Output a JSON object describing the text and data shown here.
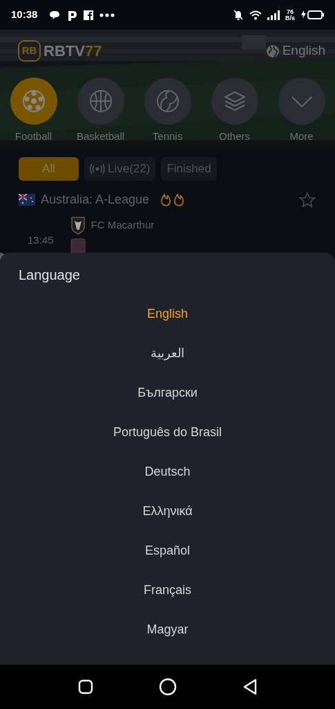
{
  "status_bar": {
    "time": "10:38",
    "net_speed_value": "76",
    "net_speed_unit": "B/s"
  },
  "header": {
    "logo_badge": "RB",
    "brand_main": "RBTV",
    "brand_accent": "77",
    "language_button": "English"
  },
  "sports": [
    {
      "label": "Football",
      "kind": "football",
      "selected": true
    },
    {
      "label": "Basketball",
      "kind": "basketball",
      "selected": false
    },
    {
      "label": "Tennis",
      "kind": "tennis",
      "selected": false
    },
    {
      "label": "Others",
      "kind": "others",
      "selected": false
    },
    {
      "label": "More",
      "kind": "more",
      "selected": false
    }
  ],
  "filters": [
    {
      "label": "All",
      "kind": "plain",
      "selected": true
    },
    {
      "label": "Live(22)",
      "kind": "live",
      "selected": false
    },
    {
      "label": "Finished",
      "kind": "plain",
      "selected": false
    }
  ],
  "league": {
    "name": "Australia: A-League"
  },
  "match": {
    "time": "13:45",
    "home_team": "FC Macarthur"
  },
  "language_sheet": {
    "title": "Language",
    "items": [
      {
        "label": "English",
        "selected": true
      },
      {
        "label": "العربية",
        "selected": false
      },
      {
        "label": "Български",
        "selected": false
      },
      {
        "label": "Português do Brasil",
        "selected": false
      },
      {
        "label": "Deutsch",
        "selected": false
      },
      {
        "label": "Ελληνικά",
        "selected": false
      },
      {
        "label": "Español",
        "selected": false
      },
      {
        "label": "Français",
        "selected": false
      },
      {
        "label": "Magyar",
        "selected": false
      }
    ]
  }
}
